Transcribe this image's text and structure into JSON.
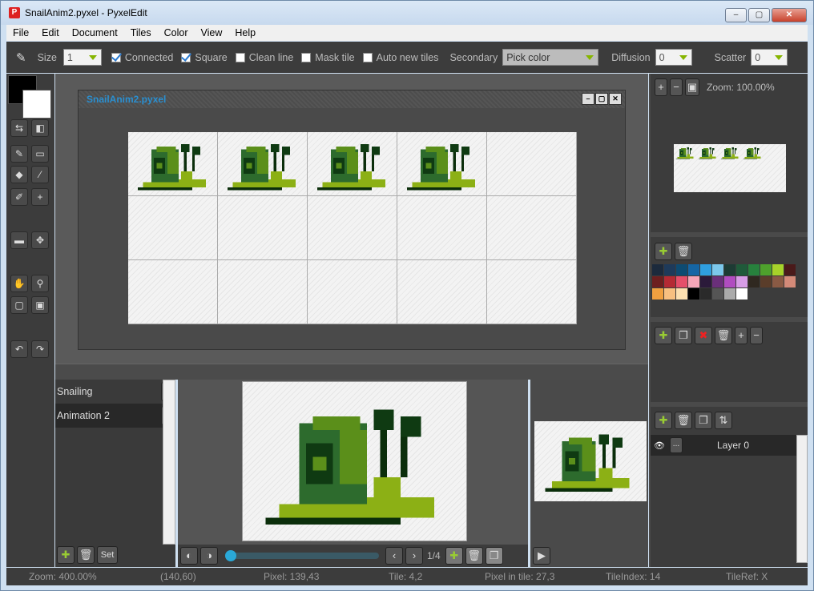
{
  "window": {
    "title": "SnailAnim2.pyxel - PyxelEdit",
    "min": "–",
    "max": "▢",
    "close": "✕"
  },
  "menu": [
    "File",
    "Edit",
    "Document",
    "Tiles",
    "Color",
    "View",
    "Help"
  ],
  "toolbar": {
    "size_label": "Size",
    "size_value": "1",
    "connected_label": "Connected",
    "connected_checked": true,
    "square_label": "Square",
    "square_checked": true,
    "clean_line_label": "Clean line",
    "mask_tile_label": "Mask tile",
    "auto_new_tiles_label": "Auto new tiles",
    "secondary_label": "Secondary",
    "secondary_value": "Pick color",
    "diffusion_label": "Diffusion",
    "diffusion_value": "0",
    "scatter_label": "Scatter",
    "scatter_value": "0"
  },
  "document": {
    "title": "SnailAnim2.pyxel",
    "btn_min": "–",
    "btn_max": "▢",
    "btn_close": "✕"
  },
  "animations": {
    "items": [
      "Snailing",
      "Animation 2"
    ],
    "more": "...",
    "set_label": "Set"
  },
  "anim_controls": {
    "frame": "1/4"
  },
  "zoom_panel": {
    "zoom_label": "Zoom: 100.00%"
  },
  "layers": {
    "name": "Layer 0",
    "more": "..."
  },
  "palette": [
    "#1c2a3c",
    "#1e3a5a",
    "#0d4b72",
    "#1566a5",
    "#2f9fe0",
    "#7cc8ec",
    "#1d3b34",
    "#1f5a3a",
    "#27813d",
    "#4ea12c",
    "#a7d32a",
    "#4a1a1a",
    "#6d1f1f",
    "#b42a34",
    "#e44f6a",
    "#f4a6b8",
    "#2b1a3a",
    "#6a2f7a",
    "#b04cc0",
    "#d79de6",
    "#2f2820",
    "#5a3d2a",
    "#8a5a44",
    "#d48a78",
    "#f0a040",
    "#f8c080",
    "#fde0b0",
    "#000000",
    "#2a2a2a",
    "#555555",
    "#aaaaaa",
    "#ffffff"
  ],
  "status": {
    "zoom": "Zoom: 400.00%",
    "coord": "(140,60)",
    "pixel": "Pixel: 139,43",
    "tile": "Tile: 4,2",
    "pixel_in_tile": "Pixel in tile: 27,3",
    "tile_index": "TileIndex: 14",
    "tile_ref": "TileRef: X"
  },
  "colors": {
    "shell_dark": "#0f3a12",
    "shell_mid": "#2d6b2d",
    "shell_light": "#5b8f1a",
    "body": "#8cb015",
    "outline": "#0b2e0b",
    "accent": "#2a8fd0"
  }
}
